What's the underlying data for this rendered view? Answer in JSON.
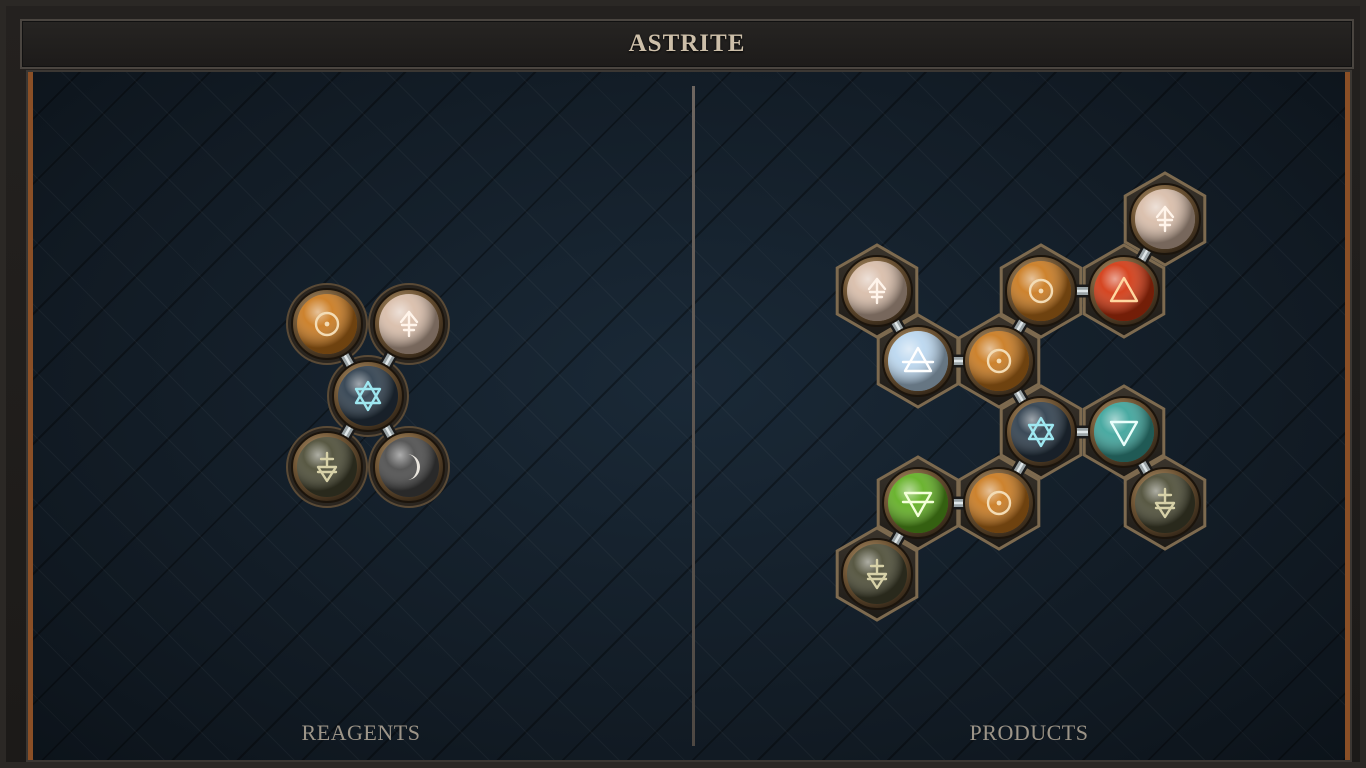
{
  "window": {
    "title": "ASTRITE"
  },
  "panels": {
    "reagents_label": "REAGENTS",
    "products_label": "PRODUCTS"
  },
  "colors": {
    "frame": "#2b2825",
    "accent_copper": "#8a4f26",
    "board_bg": "#121d27",
    "label_text": "#9d9588",
    "title_text": "#cdbfa9"
  },
  "element_types": {
    "gold": {
      "name": "gold",
      "symbol": "sun-symbol",
      "fill": "#c9781c",
      "glyph": "#f3dcb5"
    },
    "salt": {
      "name": "salt",
      "symbol": "salt-symbol",
      "fill": "#d8bca8",
      "glyph": "#fff4ea"
    },
    "quintessence": {
      "name": "quintessence",
      "symbol": "hexagram-symbol",
      "fill": "#2b3b4a",
      "glyph": "#9ee7f0"
    },
    "earth": {
      "name": "earth",
      "symbol": "earth-symbol",
      "fill": "#4a4a33",
      "glyph": "#d7d1a8"
    },
    "silver": {
      "name": "silver",
      "symbol": "moon-symbol",
      "fill": "#4a4a4a",
      "glyph": "#eae6de"
    },
    "air": {
      "name": "air",
      "symbol": "air-symbol",
      "fill": "#b9d6ef",
      "glyph": "#ffffff"
    },
    "fire": {
      "name": "fire",
      "symbol": "fire-symbol",
      "fill": "#d2360f",
      "glyph": "#ffd7a0"
    },
    "water": {
      "name": "water",
      "symbol": "water-symbol",
      "fill": "#3aa39a",
      "glyph": "#e9fffb"
    },
    "life": {
      "name": "life",
      "symbol": "life-symbol",
      "fill": "#5fae1f",
      "glyph": "#f3ffd9"
    }
  },
  "reagents": {
    "atoms": [
      {
        "id": "r1",
        "type": "gold"
      },
      {
        "id": "r2",
        "type": "salt"
      },
      {
        "id": "r3",
        "type": "quintessence"
      },
      {
        "id": "r4",
        "type": "earth"
      },
      {
        "id": "r5",
        "type": "silver"
      }
    ],
    "bonds": [
      [
        "r1",
        "r3"
      ],
      [
        "r2",
        "r3"
      ],
      [
        "r4",
        "r3"
      ],
      [
        "r5",
        "r3"
      ]
    ]
  },
  "products": {
    "atoms": [
      {
        "id": "p1",
        "type": "salt"
      },
      {
        "id": "p2",
        "type": "air"
      },
      {
        "id": "p3",
        "type": "gold"
      },
      {
        "id": "p4",
        "type": "gold"
      },
      {
        "id": "p5",
        "type": "fire"
      },
      {
        "id": "p6",
        "type": "salt"
      },
      {
        "id": "p7",
        "type": "quintessence"
      },
      {
        "id": "p8",
        "type": "water"
      },
      {
        "id": "p9",
        "type": "earth"
      },
      {
        "id": "p10",
        "type": "gold"
      },
      {
        "id": "p11",
        "type": "life"
      },
      {
        "id": "p12",
        "type": "earth"
      }
    ],
    "bonds": [
      [
        "p1",
        "p2"
      ],
      [
        "p2",
        "p3"
      ],
      [
        "p3",
        "p4"
      ],
      [
        "p4",
        "p5"
      ],
      [
        "p5",
        "p6"
      ],
      [
        "p3",
        "p7"
      ],
      [
        "p7",
        "p8"
      ],
      [
        "p8",
        "p9"
      ],
      [
        "p7",
        "p10"
      ],
      [
        "p10",
        "p11"
      ],
      [
        "p11",
        "p12"
      ]
    ]
  }
}
